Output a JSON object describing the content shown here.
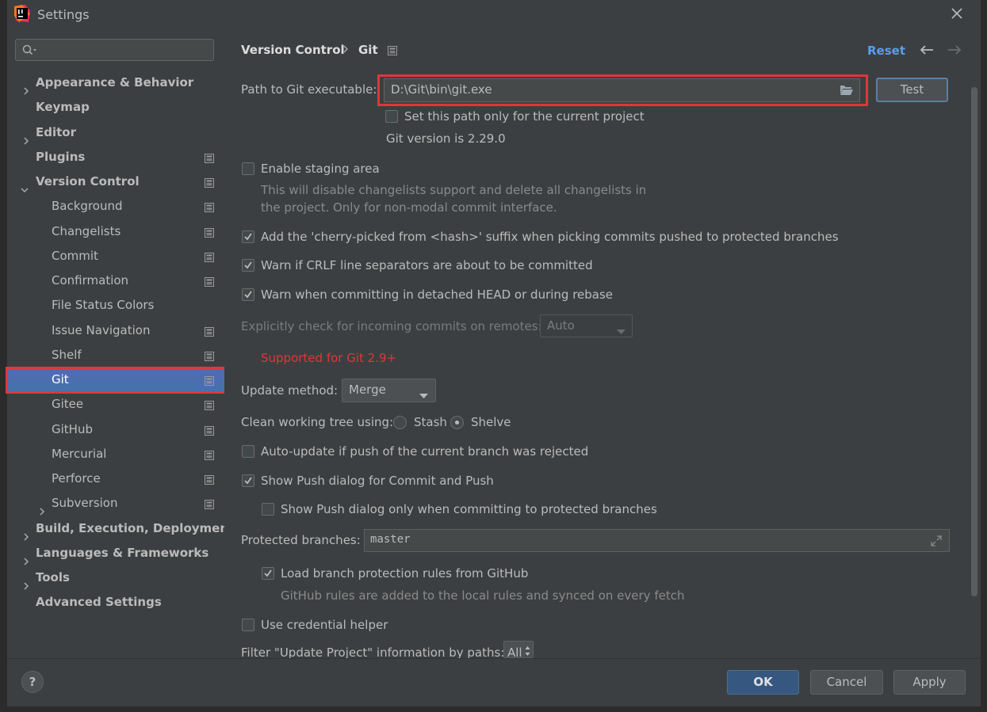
{
  "window": {
    "title": "Settings"
  },
  "sidebar": {
    "search_placeholder": "",
    "items": [
      {
        "label": "Appearance & Behavior",
        "bold": true,
        "expandable": true,
        "expanded": false
      },
      {
        "label": "Keymap",
        "bold": true
      },
      {
        "label": "Editor",
        "bold": true,
        "expandable": true,
        "expanded": false
      },
      {
        "label": "Plugins",
        "bold": true,
        "project_icon": true
      },
      {
        "label": "Version Control",
        "bold": true,
        "expandable": true,
        "expanded": true,
        "project_icon": true
      },
      {
        "label": "Background",
        "project_icon": true
      },
      {
        "label": "Changelists",
        "project_icon": true
      },
      {
        "label": "Commit",
        "project_icon": true
      },
      {
        "label": "Confirmation",
        "project_icon": true
      },
      {
        "label": "File Status Colors"
      },
      {
        "label": "Issue Navigation",
        "project_icon": true
      },
      {
        "label": "Shelf",
        "project_icon": true
      },
      {
        "label": "Git",
        "selected": true,
        "project_icon": true
      },
      {
        "label": "Gitee",
        "project_icon": true
      },
      {
        "label": "GitHub",
        "project_icon": true
      },
      {
        "label": "Mercurial",
        "project_icon": true
      },
      {
        "label": "Perforce",
        "project_icon": true
      },
      {
        "label": "Subversion",
        "expandable": true,
        "expanded": false,
        "project_icon": true
      },
      {
        "label": "Build, Execution, Deployment",
        "bold": true,
        "expandable": true,
        "expanded": false
      },
      {
        "label": "Languages & Frameworks",
        "bold": true,
        "expandable": true,
        "expanded": false
      },
      {
        "label": "Tools",
        "bold": true,
        "expandable": true,
        "expanded": false
      },
      {
        "label": "Advanced Settings",
        "bold": true
      }
    ]
  },
  "header": {
    "breadcrumb": [
      "Version Control",
      "Git"
    ],
    "reset_label": "Reset"
  },
  "git": {
    "path_label": "Path to Git executable:",
    "path_value": "D:\\Git\\bin\\git.exe",
    "test_label": "Test",
    "set_path_project_label": "Set this path only for the current project",
    "set_path_project_checked": false,
    "version_text": "Git version is 2.29.0",
    "staging_label": "Enable staging area",
    "staging_checked": false,
    "staging_hint_1": "This will disable changelists support and delete all changelists in",
    "staging_hint_2": "the project. Only for non-modal commit interface.",
    "cherry_label": "Add the 'cherry-picked from <hash>' suffix when picking commits pushed to protected branches",
    "cherry_checked": true,
    "crlf_label": "Warn if CRLF line separators are about to be committed",
    "crlf_checked": true,
    "detached_label": "Warn when committing in detached HEAD or during rebase",
    "detached_checked": true,
    "incoming_label": "Explicitly check for incoming commits on remotes:",
    "incoming_value": "Auto",
    "supported_text": "Supported for Git 2.9+",
    "update_method_label": "Update method:",
    "update_method_value": "Merge",
    "clean_tree_label": "Clean working tree using:",
    "stash_label": "Stash",
    "shelve_label": "Shelve",
    "clean_tree_selected": "Shelve",
    "auto_update_label": "Auto-update if push of the current branch was rejected",
    "auto_update_checked": false,
    "push_dialog_label": "Show Push dialog for Commit and Push",
    "push_dialog_checked": true,
    "push_protected_label": "Show Push dialog only when committing to protected branches",
    "push_protected_checked": false,
    "protected_branches_label": "Protected branches:",
    "protected_branches_value": "master",
    "load_rules_label": "Load branch protection rules from GitHub",
    "load_rules_checked": true,
    "load_rules_hint": "GitHub rules are added to the local rules and synced on every fetch",
    "credential_label": "Use credential helper",
    "credential_checked": false,
    "filter_label": "Filter \"Update Project\" information by paths:",
    "filter_value": "All"
  },
  "footer": {
    "help_label": "?",
    "ok_label": "OK",
    "cancel_label": "Cancel",
    "apply_label": "Apply"
  },
  "colors": {
    "background": "#3c3f41",
    "selection": "#4b6eaf",
    "link": "#589df6",
    "warning": "#e0363a",
    "highlight_box": "#e0363a",
    "ok_button": "#365880"
  }
}
